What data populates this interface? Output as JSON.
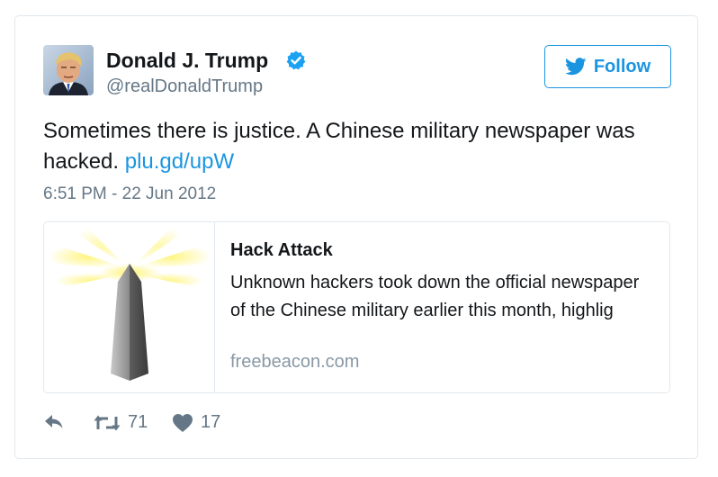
{
  "author": {
    "name": "Donald J. Trump",
    "handle": "@realDonaldTrump",
    "verified": true
  },
  "follow_button": {
    "label": "Follow",
    "icon": "twitter-bird-icon"
  },
  "tweet": {
    "text": "Sometimes there is justice. A Chinese military newspaper was hacked.",
    "link_text": "plu.gd/upW",
    "timestamp": "6:51 PM - 22 Jun 2012"
  },
  "link_card": {
    "title": "Hack Attack",
    "description": "Unknown hackers took down the official newspaper of the Chinese military earlier this month, highlig",
    "domain": "freebeacon.com",
    "image": "lighthouse-beacon-logo"
  },
  "actions": {
    "reply_icon": "reply-icon",
    "retweet_icon": "retweet-icon",
    "retweet_count": "71",
    "like_icon": "heart-icon",
    "like_count": "17"
  },
  "colors": {
    "accent": "#1b95e0",
    "text": "#14171a",
    "secondary": "#657786",
    "border": "#e1e8ed"
  }
}
